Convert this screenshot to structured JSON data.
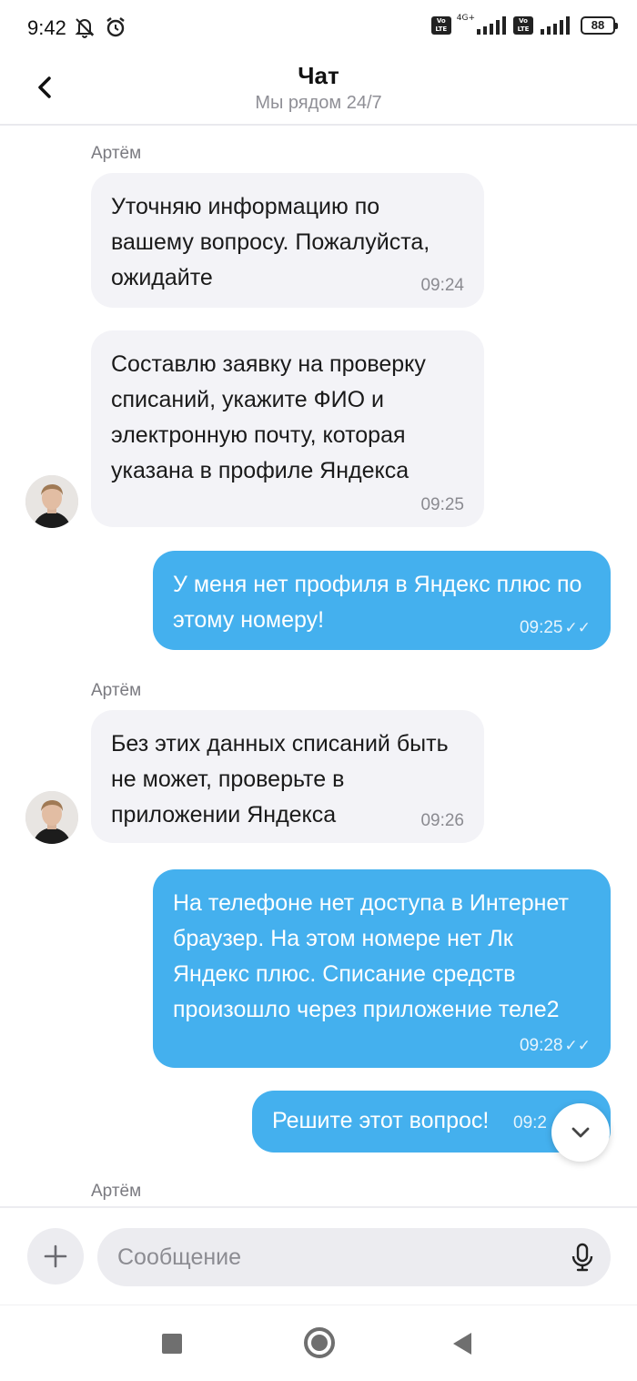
{
  "status_bar": {
    "time": "9:42",
    "network_label": "4G+",
    "volte_label": "Vo LTE",
    "battery": "88"
  },
  "header": {
    "title": "Чат",
    "subtitle": "Мы рядом 24/7"
  },
  "messages": [
    {
      "sender": "Артём",
      "direction": "in",
      "text": "Уточняю информацию по вашему вопросу. Пожалуйста, ожидайте",
      "time": "09:24"
    },
    {
      "direction": "in",
      "text": "Составлю заявку на проверку списаний, укажите ФИО и электронную почту, которая указана в профиле Яндекса",
      "time": "09:25"
    },
    {
      "direction": "out",
      "text": "У меня нет профиля в Яндекс плюс по этому номеру!",
      "time": "09:25",
      "ticks": "✓✓"
    },
    {
      "sender": "Артём",
      "direction": "in",
      "text": "Без этих данных списаний быть не может, проверьте в приложении Яндекса",
      "time": "09:26"
    },
    {
      "direction": "out",
      "text": "На телефоне нет доступа в Интернет браузер. На этом номере нет Лк Яндекс плюс. Списание средств произошло через приложение теле2",
      "time": "09:28",
      "ticks": "✓✓"
    },
    {
      "direction": "out",
      "text": "Решите этот вопрос!",
      "time": "09:2"
    },
    {
      "sender": "Артём"
    }
  ],
  "composer": {
    "placeholder": "Сообщение"
  },
  "colors": {
    "accent": "#44b0ee",
    "incoming_bubble": "#f3f3f7",
    "composer_bg": "#ececf0"
  },
  "icons": {
    "back": "chevron-left-icon",
    "scroll_down": "chevron-down-icon",
    "add": "plus-icon",
    "mic": "microphone-icon"
  }
}
